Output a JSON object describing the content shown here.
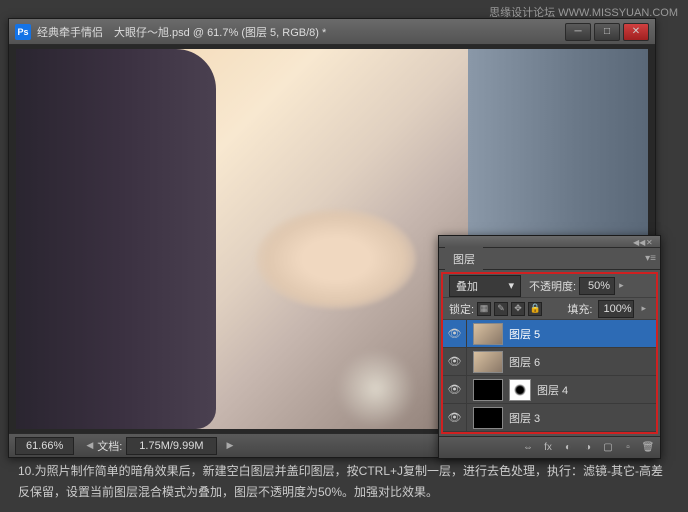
{
  "watermark": "思缘设计论坛  WWW.MISSYUAN.COM",
  "window": {
    "title": "经典牵手情侣　大眼仔～旭.psd @ 61.7% (图层 5, RGB/8) *",
    "ps_logo": "Ps"
  },
  "statusbar": {
    "zoom": "61.66%",
    "doc_label": "文档:",
    "doc_info": "1.75M/9.99M"
  },
  "layers_panel": {
    "tab": "图层",
    "blend_mode": "叠加",
    "opacity_label": "不透明度:",
    "opacity_value": "50%",
    "lock_label": "锁定:",
    "fill_label": "填充:",
    "fill_value": "100%",
    "layers": [
      {
        "name": "图层 5",
        "selected": true,
        "thumb": "img"
      },
      {
        "name": "图层 6",
        "selected": false,
        "thumb": "img"
      },
      {
        "name": "图层 4",
        "selected": false,
        "thumb": "black",
        "mask": true
      },
      {
        "name": "图层 3",
        "selected": false,
        "thumb": "black"
      }
    ]
  },
  "caption": "10.为照片制作简单的暗角效果后，新建空白图层并盖印图层，按CTRL+J复制一层，进行去色处理，执行：滤镜-其它-高差反保留，设置当前图层混合模式为叠加，图层不透明度为50%。加强对比效果。"
}
